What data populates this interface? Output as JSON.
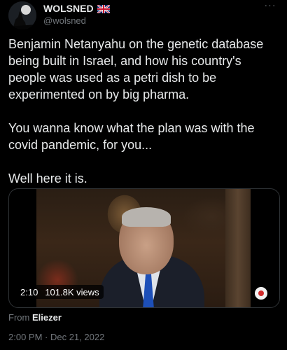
{
  "author": {
    "display_name": "WOLSNED",
    "handle": "@wolsned",
    "flag_icon": "uk-flag-icon"
  },
  "tweet": {
    "text": "Benjamin Netanyahu on the genetic database being built in Israel, and how his country's people was used as a petri dish to be experimented on by big pharma.\n\nYou wanna know what the plan was with the covid pandemic, for you...\n\nWell here it is."
  },
  "media": {
    "duration": "2:10",
    "views": "101.8K views"
  },
  "source": {
    "prefix": "From",
    "name": "Eliezer"
  },
  "timestamp": "2:00 PM · Dec 21, 2022",
  "colors": {
    "background": "#000000",
    "text": "#e7e9ea",
    "secondary": "#71767b",
    "border": "#2f3336"
  }
}
